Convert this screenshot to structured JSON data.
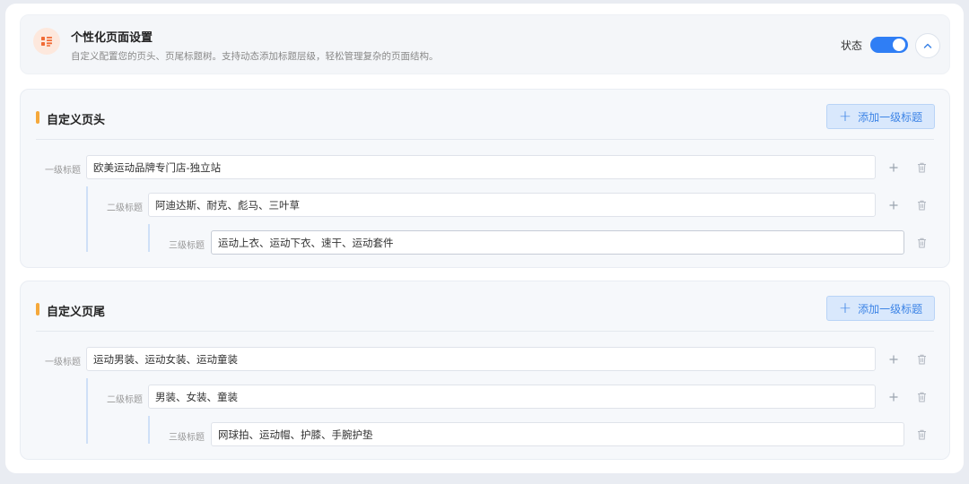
{
  "header": {
    "title": "个性化页面设置",
    "description": "自定义配置您的页头、页尾标题树。支持动态添加标题层级，轻松管理复杂的页面结构。",
    "status_label": "状态",
    "status_on": true,
    "icon": "list-settings-icon"
  },
  "colors": {
    "accent_blue": "#2f7ef5",
    "marker_orange": "#f5a83b",
    "icon_orange": "#f06a35"
  },
  "sections": [
    {
      "title": "自定义页头",
      "add_button_label": "添加一级标题",
      "rows": [
        {
          "label": "一级标题",
          "value": "欧美运动品牌专门店-独立站"
        },
        {
          "label": "二级标题",
          "value": "阿迪达斯、耐克、彪马、三叶草"
        },
        {
          "label": "三级标题",
          "value": "运动上衣、运动下衣、速干、运动套件"
        }
      ]
    },
    {
      "title": "自定义页尾",
      "add_button_label": "添加一级标题",
      "rows": [
        {
          "label": "一级标题",
          "value": "运动男装、运动女装、运动童装"
        },
        {
          "label": "二级标题",
          "value": "男装、女装、童装"
        },
        {
          "label": "三级标题",
          "value": "网球拍、运动帽、护膝、手腕护垫"
        }
      ]
    }
  ]
}
